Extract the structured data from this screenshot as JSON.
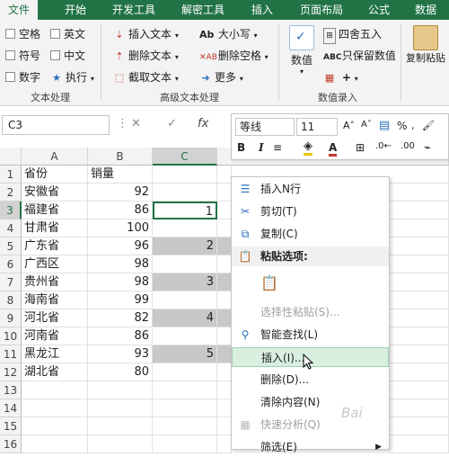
{
  "tabs": [
    "文件",
    "开始",
    "开发工具",
    "解密工具",
    "插入",
    "页面布局",
    "公式",
    "数据"
  ],
  "ribbon": {
    "checkboxes": [
      {
        "label": "空格"
      },
      {
        "label": "英文"
      },
      {
        "label": "符号"
      },
      {
        "label": "中文"
      },
      {
        "label": "数字"
      }
    ],
    "exec_label": "执行",
    "group1_label": "文本处理",
    "adv": {
      "insert_text": "插入文本",
      "delete_text": "删除文本",
      "cut_text": "截取文本",
      "case": "大小写",
      "delete_space": "删除空格",
      "more": "更多",
      "group_label": "高级文本处理"
    },
    "numeric": {
      "value_label": "数值",
      "round": "四舍五入",
      "keep_value": "只保留数值",
      "calc": "计算",
      "group_label": "数值录入"
    },
    "copy_paste": "复制粘贴"
  },
  "formula_bar": {
    "name_box": "C3",
    "cancel": "✕",
    "enter": "✓",
    "fx": "fx"
  },
  "mini_toolbar": {
    "font": "等线",
    "size": "11",
    "bold": "B",
    "italic": "I",
    "font_color_letter": "A"
  },
  "grid": {
    "columns": [
      "A",
      "B",
      "C"
    ],
    "rows": [
      {
        "n": "1",
        "a": "省份",
        "b": "销量",
        "c": "",
        "gray": false
      },
      {
        "n": "2",
        "a": "安徽省",
        "b": "92",
        "c": "",
        "gray": false
      },
      {
        "n": "3",
        "a": "福建省",
        "b": "86",
        "c": "1",
        "gray": false
      },
      {
        "n": "4",
        "a": "甘肃省",
        "b": "100",
        "c": "",
        "gray": false
      },
      {
        "n": "5",
        "a": "广东省",
        "b": "96",
        "c": "2",
        "gray": true
      },
      {
        "n": "6",
        "a": "广西区",
        "b": "98",
        "c": "",
        "gray": false
      },
      {
        "n": "7",
        "a": "贵州省",
        "b": "98",
        "c": "3",
        "gray": true
      },
      {
        "n": "8",
        "a": "海南省",
        "b": "99",
        "c": "",
        "gray": false
      },
      {
        "n": "9",
        "a": "河北省",
        "b": "82",
        "c": "4",
        "gray": true
      },
      {
        "n": "10",
        "a": "河南省",
        "b": "86",
        "c": "",
        "gray": false
      },
      {
        "n": "11",
        "a": "黑龙江",
        "b": "93",
        "c": "5",
        "gray": true
      },
      {
        "n": "12",
        "a": "湖北省",
        "b": "80",
        "c": "",
        "gray": false
      },
      {
        "n": "13",
        "a": "",
        "b": "",
        "c": "",
        "gray": false
      },
      {
        "n": "14",
        "a": "",
        "b": "",
        "c": "",
        "gray": false
      },
      {
        "n": "15",
        "a": "",
        "b": "",
        "c": "",
        "gray": false
      },
      {
        "n": "16",
        "a": "",
        "b": "",
        "c": "",
        "gray": false
      }
    ]
  },
  "context_menu": [
    {
      "label": "插入N行",
      "icon": "insert-rows-icon",
      "glyph": "☰",
      "state": "normal"
    },
    {
      "label": "剪切(T)",
      "icon": "scissors-icon",
      "glyph": "✂",
      "state": "normal"
    },
    {
      "label": "复制(C)",
      "icon": "copy-icon",
      "glyph": "⧉",
      "state": "normal"
    },
    {
      "label": "粘贴选项:",
      "icon": "paste-icon",
      "glyph": "📋",
      "state": "header"
    },
    {
      "label": "",
      "icon": "paste-option-icon",
      "glyph": "📋",
      "state": "tall"
    },
    {
      "label": "选择性粘贴(S)...",
      "icon": "",
      "glyph": "",
      "state": "disabled"
    },
    {
      "label": "智能查找(L)",
      "icon": "smart-lookup-icon",
      "glyph": "⚲",
      "state": "normal"
    },
    {
      "label": "插入(I)...",
      "icon": "",
      "glyph": "",
      "state": "hl"
    },
    {
      "label": "删除(D)...",
      "icon": "",
      "glyph": "",
      "state": "normal"
    },
    {
      "label": "清除内容(N)",
      "icon": "",
      "glyph": "",
      "state": "normal"
    },
    {
      "label": "快速分析(Q)",
      "icon": "quick-analysis-icon",
      "glyph": "▦",
      "state": "disabled"
    },
    {
      "label": "筛选(E)",
      "icon": "",
      "glyph": "",
      "state": "submenu"
    }
  ],
  "watermark": "Bai",
  "colors": {
    "excel_green": "#217346",
    "highlight": "#d9efe0",
    "gray_cell": "#c8c8c8"
  }
}
